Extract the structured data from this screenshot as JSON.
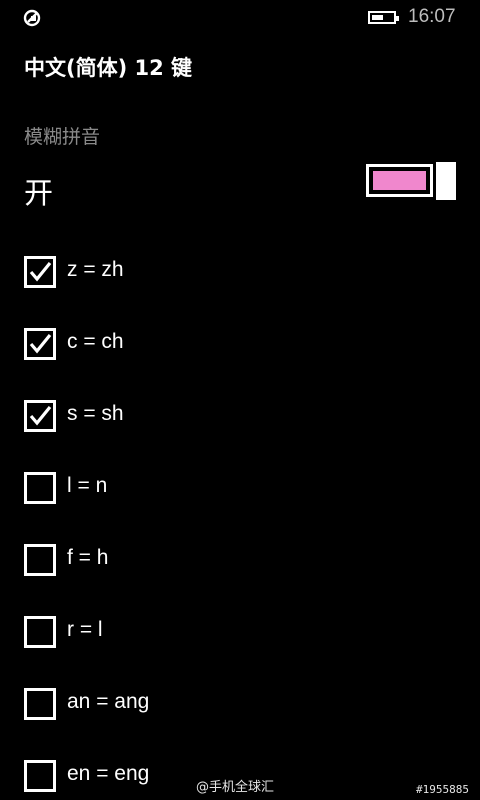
{
  "status_bar": {
    "left_icon": "app-notification-icon",
    "battery_level": 0.6,
    "time": "16:07"
  },
  "header": {
    "title": "中文(简体) 12 键"
  },
  "fuzzy_pinyin": {
    "section_label": "模糊拼音",
    "state_label": "开",
    "toggle_on": true,
    "toggle_color": "#f087cd"
  },
  "options": [
    {
      "label": "z = zh",
      "checked": true
    },
    {
      "label": "c = ch",
      "checked": true
    },
    {
      "label": "s = sh",
      "checked": true
    },
    {
      "label": "l = n",
      "checked": false
    },
    {
      "label": "f = h",
      "checked": false
    },
    {
      "label": "r = l",
      "checked": false
    },
    {
      "label": "an = ang",
      "checked": false
    },
    {
      "label": "en = eng",
      "checked": false
    }
  ],
  "watermarks": {
    "source": "@手机全球汇",
    "id": "#1955885"
  }
}
